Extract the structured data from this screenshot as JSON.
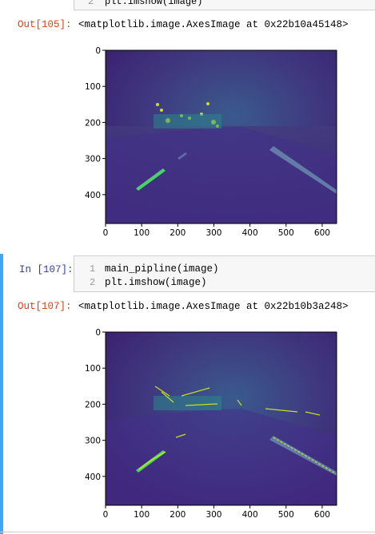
{
  "cells": [
    {
      "code_lines": [
        {
          "number": "2",
          "text": "plt.imshow(image)"
        }
      ],
      "output_prompt": "Out[105]:",
      "output_repr": "<matplotlib.image.AxesImage at 0x22b10a45148>",
      "chart_data": {
        "type": "image",
        "x_ticks": [
          "0",
          "100",
          "200",
          "300",
          "400",
          "500",
          "600"
        ],
        "y_ticks": [
          "0",
          "100",
          "200",
          "300",
          "400"
        ],
        "xlim": [
          0,
          640
        ],
        "ylim": [
          480,
          0
        ],
        "colormap": "viridis"
      }
    },
    {
      "input_prompt": "In [107]:",
      "code_lines": [
        {
          "number": "1",
          "text": "main_pipline(image)"
        },
        {
          "number": "2",
          "text": "plt.imshow(image)"
        }
      ],
      "output_prompt": "Out[107]:",
      "output_repr": "<matplotlib.image.AxesImage at 0x22b10b3a248>",
      "chart_data": {
        "type": "image",
        "x_ticks": [
          "0",
          "100",
          "200",
          "300",
          "400",
          "500",
          "600"
        ],
        "y_ticks": [
          "0",
          "100",
          "200",
          "300",
          "400"
        ],
        "xlim": [
          0,
          640
        ],
        "ylim": [
          480,
          0
        ],
        "colormap": "viridis"
      }
    }
  ],
  "colors": {
    "out_prompt": "#d84315",
    "in_prompt": "#303f9f",
    "selected_border": "#42a5f5"
  }
}
